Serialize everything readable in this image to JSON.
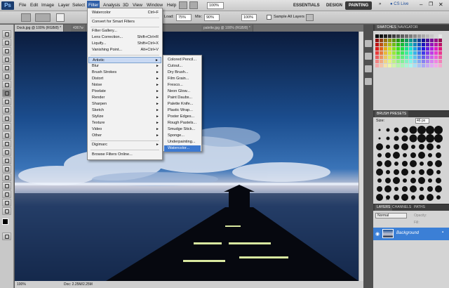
{
  "app": {
    "logo": "Ps"
  },
  "menubar": {
    "items": [
      "File",
      "Edit",
      "Image",
      "Layer",
      "Select",
      "Filter",
      "Analysis",
      "3D",
      "View",
      "Window",
      "Help"
    ],
    "zoom": "100%",
    "workspaces": [
      "ESSENTIALS",
      "DESIGN",
      "PAINTING"
    ],
    "cs_live": "CS Live"
  },
  "options": {
    "load_label": "Load:",
    "load_value": "75%",
    "mix_label": "Mix:",
    "mix_value": "90%",
    "flow_value": "100%",
    "sample_all_layers": "Sample All Layers"
  },
  "doc_tabs": [
    "Dock.jpg @ 100% (RGB/8) *",
    "4367w",
    "palette.jpg @ 100% (RGB/8) *"
  ],
  "status": {
    "zoom": "100%",
    "doc": "Doc: 2.25M/2.25M"
  },
  "filter_menu": {
    "items": [
      {
        "label": "Watercolor",
        "shortcut": "Ctrl+F"
      },
      {
        "label": "Convert for Smart Filters",
        "shortcut": ""
      },
      {
        "label": "Filter Gallery...",
        "shortcut": ""
      },
      {
        "label": "Lens Correction...",
        "shortcut": "Shift+Ctrl+R"
      },
      {
        "label": "Liquify...",
        "shortcut": "Shift+Ctrl+X"
      },
      {
        "label": "Vanishing Point...",
        "shortcut": "Alt+Ctrl+V"
      },
      {
        "label": "Artistic"
      },
      {
        "label": "Blur"
      },
      {
        "label": "Brush Strokes"
      },
      {
        "label": "Distort"
      },
      {
        "label": "Noise"
      },
      {
        "label": "Pixelate"
      },
      {
        "label": "Render"
      },
      {
        "label": "Sharpen"
      },
      {
        "label": "Sketch"
      },
      {
        "label": "Stylize"
      },
      {
        "label": "Texture"
      },
      {
        "label": "Video"
      },
      {
        "label": "Other"
      },
      {
        "label": "Digimarc"
      },
      {
        "label": "Browse Filters Online..."
      }
    ]
  },
  "artistic_menu": {
    "items": [
      "Colored Pencil...",
      "Cutout...",
      "Dry Brush...",
      "Film Grain...",
      "Fresco...",
      "Neon Glow...",
      "Paint Daubs...",
      "Palette Knife...",
      "Plastic Wrap...",
      "Poster Edges...",
      "Rough Pastels...",
      "Smudge Stick...",
      "Sponge...",
      "Underpainting...",
      "Watercolor..."
    ]
  },
  "panels": {
    "swatches_tab": "SWATCHES",
    "navigator_tab": "NAVIGATOR",
    "brush_presets_tab": "BRUSH PRESETS",
    "size_label": "Size:",
    "size_value": "46 px",
    "brush_sizes": [
      "23",
      "23",
      "45",
      "36",
      "14",
      "11"
    ],
    "layers_tab": "LAYERS",
    "channels_tab": "CHANNELS",
    "paths_tab": "PATHS",
    "blend_mode": "Normal",
    "opacity_label": "Opacity:",
    "fill_label": "Fill:",
    "layer_name": "Background"
  },
  "colors": {
    "accent": "#3d79d0",
    "menu_hl": "#c9d9f3",
    "layer_sel": "#3b7fd6"
  }
}
